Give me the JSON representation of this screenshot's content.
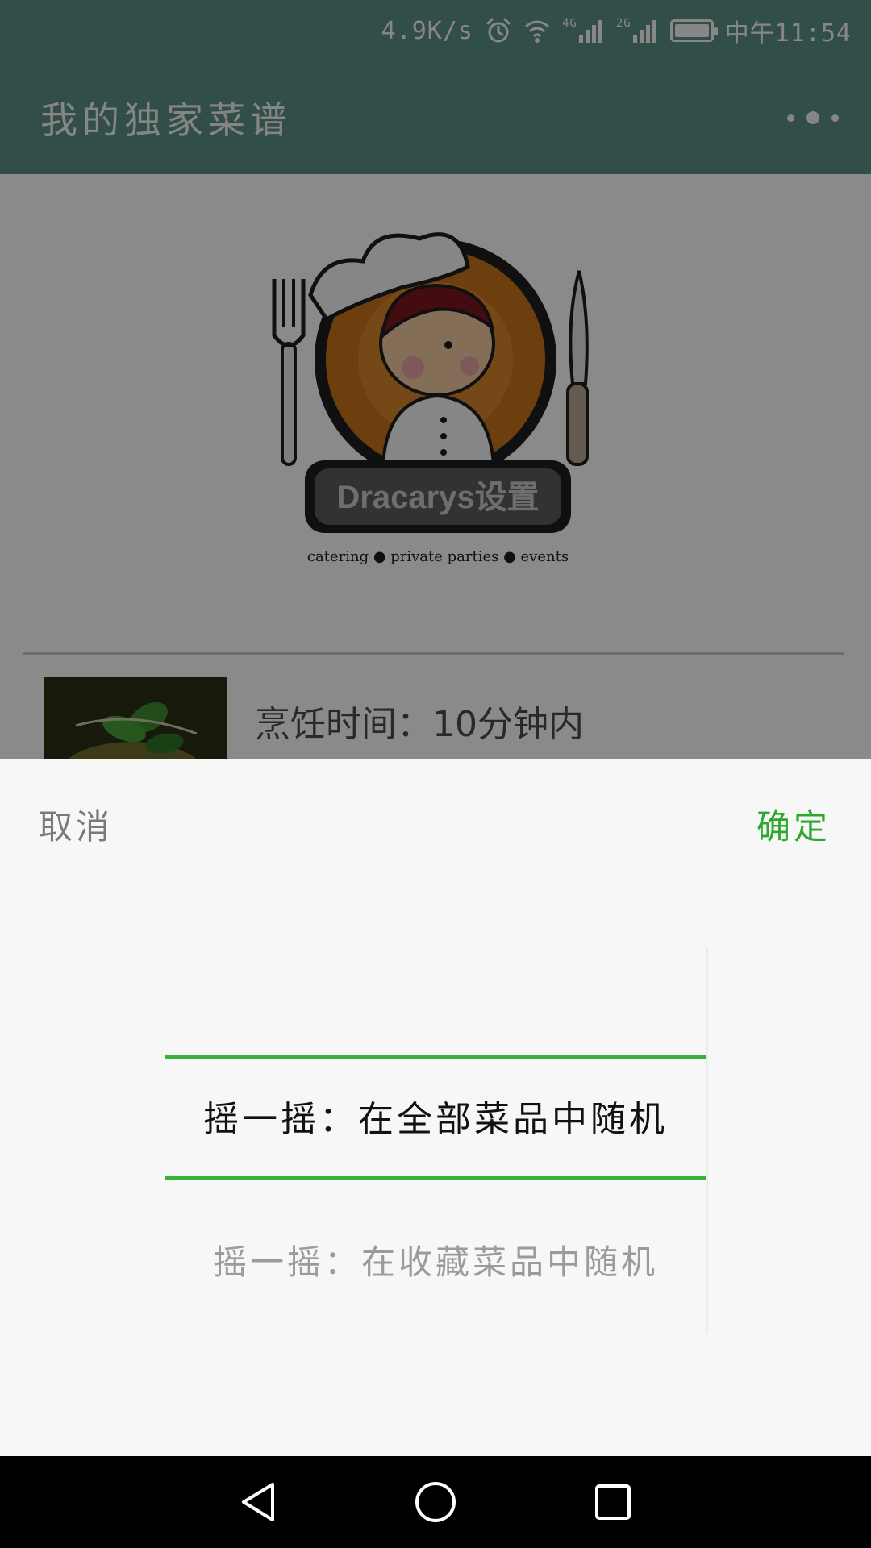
{
  "status_bar": {
    "network_speed": "4.9K/s",
    "net_4g": "4G",
    "net_2g": "2G",
    "time": "中午11:54",
    "icons": [
      "alarm-icon",
      "wifi-icon",
      "signal-4g-icon",
      "signal-2g-icon",
      "battery-icon"
    ]
  },
  "app_bar": {
    "title": "我的独家菜谱",
    "overflow_icon": "overflow-menu-icon"
  },
  "content": {
    "logo": {
      "name": "Dracarys设置",
      "tagline": "catering ● private parties ● events",
      "colors": {
        "orange": "#c7731a",
        "dark": "#1e1e1e",
        "banner": "#5b5b5b"
      }
    },
    "recipe_item": {
      "cook_time": "烹饪时间：10分钟内"
    }
  },
  "picker_sheet": {
    "cancel_label": "取消",
    "confirm_label": "确定",
    "options": [
      "摇一摇：在全部菜品中随机",
      "摇一摇：在收藏菜品中随机"
    ],
    "selected_index": 0,
    "colors": {
      "accent": "#3ab13a",
      "confirm": "#2ea72e"
    }
  },
  "nav_bar": {
    "buttons": [
      "back-icon",
      "home-icon",
      "recents-icon"
    ]
  }
}
